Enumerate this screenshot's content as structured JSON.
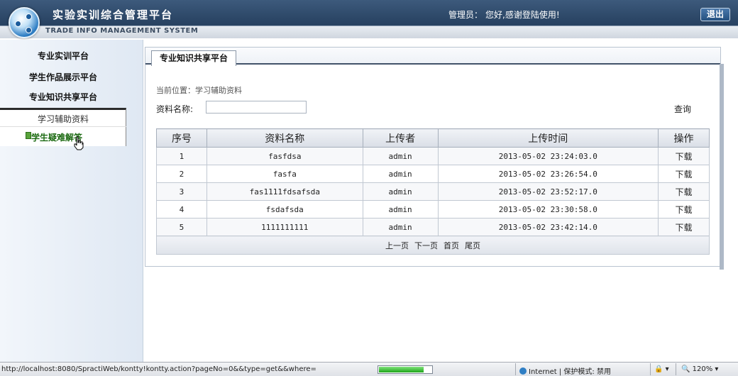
{
  "header": {
    "title": "实验实训综合管理平台",
    "subtitle": "TRADE INFO MANAGEMENT SYSTEM",
    "admin_label": "管理员：",
    "welcome": "您好,感谢登陆使用!",
    "logout_label": "退出"
  },
  "sidebar": {
    "items": [
      {
        "label": "专业实训平台"
      },
      {
        "label": "学生作品展示平台"
      },
      {
        "label": "专业知识共享平台"
      }
    ],
    "sub_items": [
      {
        "label": "学习辅助资料"
      },
      {
        "label": "学生疑难解答"
      }
    ]
  },
  "main": {
    "tab_label": "专业知识共享平台",
    "breadcrumb": "当前位置：学习辅助资料",
    "search": {
      "label": "资料名称:",
      "value": "",
      "placeholder": "",
      "query_label": "查询"
    },
    "table": {
      "columns": [
        "序号",
        "资料名称",
        "上传者",
        "上传时间",
        "操作"
      ],
      "rows": [
        {
          "no": "1",
          "name": "fasfdsa",
          "uploader": "admin",
          "time": "2013-05-02 23:24:03.0",
          "action": "下载"
        },
        {
          "no": "2",
          "name": "fasfa",
          "uploader": "admin",
          "time": "2013-05-02 23:26:54.0",
          "action": "下载"
        },
        {
          "no": "3",
          "name": "fas1111fdsafsda",
          "uploader": "admin",
          "time": "2013-05-02 23:52:17.0",
          "action": "下载"
        },
        {
          "no": "4",
          "name": "fsdafsda",
          "uploader": "admin",
          "time": "2013-05-02 23:30:58.0",
          "action": "下载"
        },
        {
          "no": "5",
          "name": "1111111111",
          "uploader": "admin",
          "time": "2013-05-02 23:42:14.0",
          "action": "下载"
        }
      ]
    },
    "pager": {
      "prev": "上一页",
      "next": "下一页",
      "first": "首页",
      "last": "尾页"
    }
  },
  "statusbar": {
    "url": "http://localhost:8080/SpractiWeb/kontty!kontty.action?pageNo=0&&type=get&&where=",
    "progress": 0.85,
    "zone": "Internet | 保护模式: 禁用",
    "misc": "🔒 ▾",
    "zoom": "120%"
  },
  "colors": {
    "header_bg": "#2c4767",
    "accent_green": "#1c6a12",
    "sidebar_bg": "#dfe8f3"
  }
}
